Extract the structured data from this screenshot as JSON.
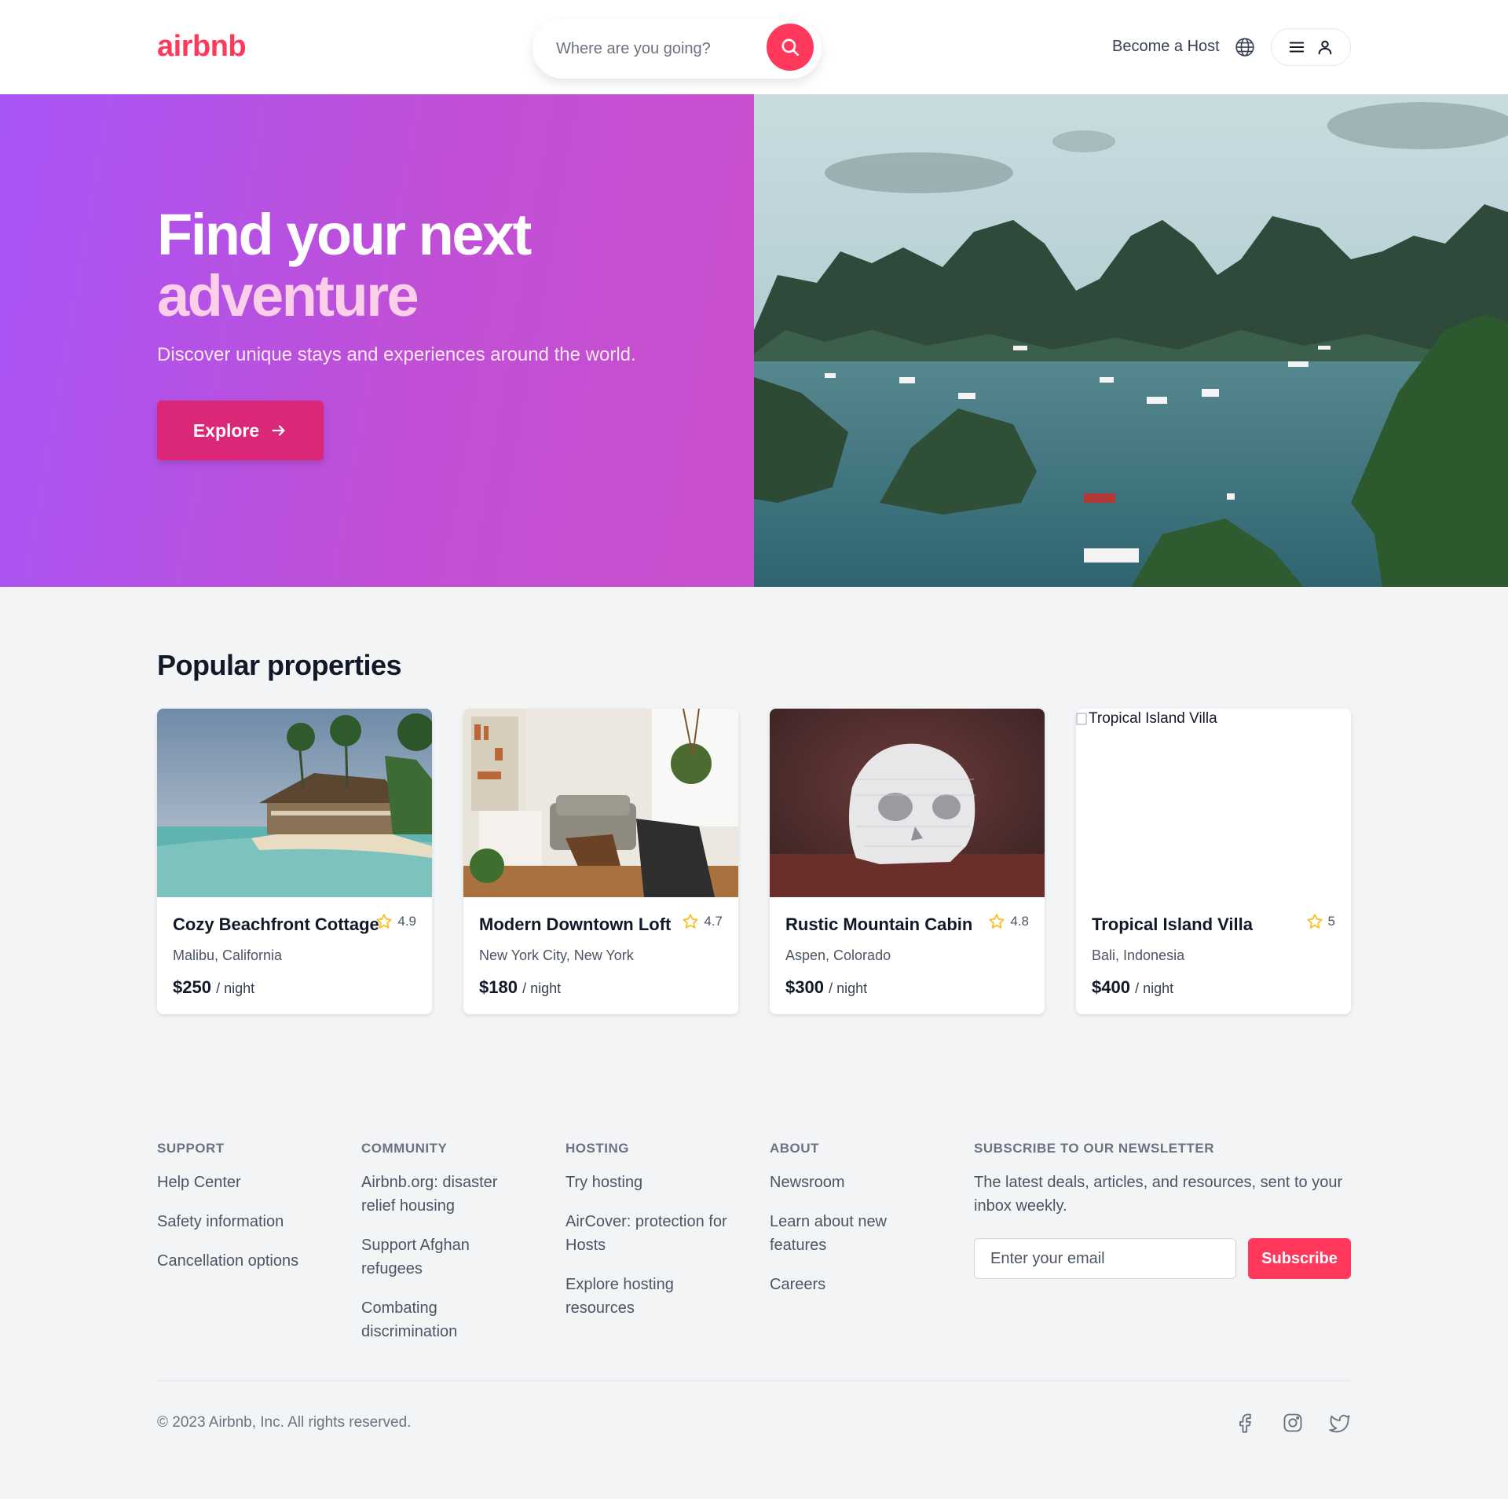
{
  "header": {
    "logo": "airbnb",
    "search_placeholder": "Where are you going?",
    "host_link": "Become a Host"
  },
  "hero": {
    "title_line1": "Find your next",
    "title_line2": "adventure",
    "subtitle": "Discover unique stays and experiences around the world.",
    "cta_label": "Explore"
  },
  "properties": {
    "title": "Popular properties",
    "items": [
      {
        "name": "Cozy Beachfront Cottage",
        "rating": "4.9",
        "location": "Malibu, California",
        "price": "$250",
        "per": "/ night"
      },
      {
        "name": "Modern Downtown Loft",
        "rating": "4.7",
        "location": "New York City, New York",
        "price": "$180",
        "per": "/ night"
      },
      {
        "name": "Rustic Mountain Cabin",
        "rating": "4.8",
        "location": "Aspen, Colorado",
        "price": "$300",
        "per": "/ night"
      },
      {
        "name": "Tropical Island Villa",
        "rating": "5",
        "location": "Bali, Indonesia",
        "price": "$400",
        "per": "/ night",
        "image_alt": "Tropical Island Villa"
      }
    ]
  },
  "footer": {
    "columns": [
      {
        "heading": "SUPPORT",
        "links": [
          "Help Center",
          "Safety information",
          "Cancellation options"
        ]
      },
      {
        "heading": "COMMUNITY",
        "links": [
          "Airbnb.org: disaster relief housing",
          "Support Afghan refugees",
          "Combating discrimination"
        ]
      },
      {
        "heading": "HOSTING",
        "links": [
          "Try hosting",
          "AirCover: protection for Hosts",
          "Explore hosting resources"
        ]
      },
      {
        "heading": "ABOUT",
        "links": [
          "Newsroom",
          "Learn about new features",
          "Careers"
        ]
      }
    ],
    "newsletter": {
      "heading": "SUBSCRIBE TO OUR NEWSLETTER",
      "text": "The latest deals, articles, and resources, sent to your inbox weekly.",
      "placeholder": "Enter your email",
      "button": "Subscribe"
    },
    "copyright": "© 2023 Airbnb, Inc. All rights reserved.",
    "socials": [
      "facebook-icon",
      "instagram-icon",
      "twitter-icon"
    ]
  },
  "colors": {
    "brand": "#ff385c",
    "hero_gradient_start": "#a855f7",
    "hero_gradient_end": "#c94fcc",
    "cta": "#db2777",
    "star": "#fbbf24"
  }
}
